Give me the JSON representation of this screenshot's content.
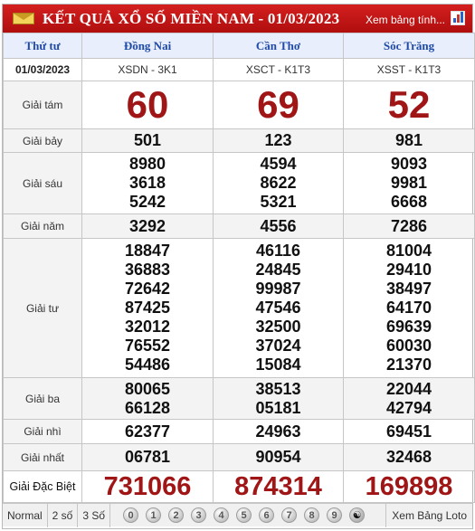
{
  "header": {
    "title": "KẾT QUẢ XỔ SỐ MIỀN NAM - 01/03/2023",
    "stats_link": "Xem bảng tính..."
  },
  "columns": {
    "day": "Thứ tư",
    "provinces": [
      "Đồng Nai",
      "Cần Thơ",
      "Sóc Trăng"
    ],
    "date": "01/03/2023",
    "codes": [
      "XSDN - 3K1",
      "XSCT - K1T3",
      "XSST - K1T3"
    ]
  },
  "prizes": {
    "g8": {
      "label": "Giải tám",
      "values": [
        "60",
        "69",
        "52"
      ]
    },
    "g7": {
      "label": "Giải bảy",
      "values": [
        "501",
        "123",
        "981"
      ]
    },
    "g6": {
      "label": "Giải sáu",
      "values": [
        [
          "8980",
          "3618",
          "5242"
        ],
        [
          "4594",
          "8622",
          "5321"
        ],
        [
          "9093",
          "9981",
          "6668"
        ]
      ]
    },
    "g5": {
      "label": "Giải năm",
      "values": [
        "3292",
        "4556",
        "7286"
      ]
    },
    "g4": {
      "label": "Giải tư",
      "values": [
        [
          "18847",
          "36883",
          "72642",
          "87425",
          "32012",
          "76552",
          "54486"
        ],
        [
          "46116",
          "24845",
          "99987",
          "47546",
          "32500",
          "37024",
          "15084"
        ],
        [
          "81004",
          "29410",
          "38497",
          "64170",
          "69639",
          "60030",
          "21370"
        ]
      ]
    },
    "g3": {
      "label": "Giải ba",
      "values": [
        [
          "80065",
          "66128"
        ],
        [
          "38513",
          "05181"
        ],
        [
          "22044",
          "42794"
        ]
      ]
    },
    "g2": {
      "label": "Giải nhì",
      "values": [
        "62377",
        "24963",
        "69451"
      ]
    },
    "g1": {
      "label": "Giải nhất",
      "values": [
        "06781",
        "90954",
        "32468"
      ]
    },
    "gdb": {
      "label": "Giải Đặc Biệt",
      "values": [
        "731066",
        "874314",
        "169898"
      ]
    }
  },
  "footer": {
    "options": [
      "Normal",
      "2 số",
      "3 Số"
    ],
    "digits": [
      "0",
      "1",
      "2",
      "3",
      "4",
      "5",
      "6",
      "7",
      "8",
      "9"
    ],
    "yin_yang": "☯",
    "loto_link": "Xem Bảng Loto"
  }
}
